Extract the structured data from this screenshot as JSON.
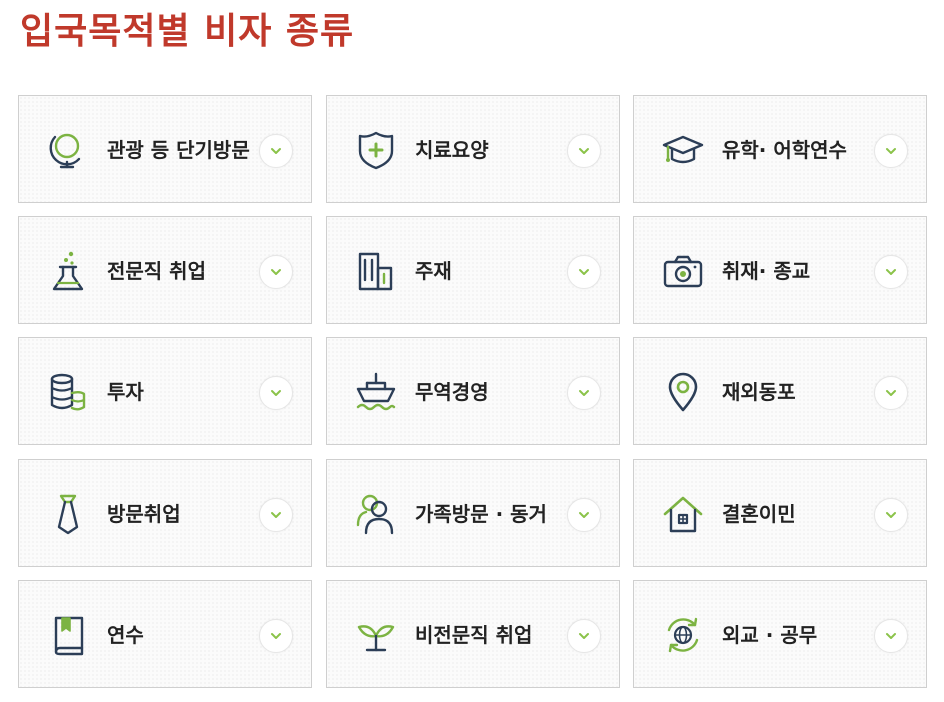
{
  "page": {
    "title": "입국목적별 비자 종류"
  },
  "colors": {
    "title": "#c0392b",
    "icon_navy": "#2c3e57",
    "icon_green": "#7cb342",
    "chevron": "#8bc34a"
  },
  "cards": [
    {
      "label": "관광 등 단기방문",
      "icon": "globe-icon"
    },
    {
      "label": "치료요양",
      "icon": "shield-cross-icon"
    },
    {
      "label": "유학· 어학연수",
      "icon": "graduation-cap-icon"
    },
    {
      "label": "전문직 취업",
      "icon": "flask-icon"
    },
    {
      "label": "주재",
      "icon": "building-icon"
    },
    {
      "label": "취재· 종교",
      "icon": "camera-icon"
    },
    {
      "label": "투자",
      "icon": "coin-stack-icon"
    },
    {
      "label": "무역경영",
      "icon": "ship-icon"
    },
    {
      "label": "재외동포",
      "icon": "map-pin-icon"
    },
    {
      "label": "방문취업",
      "icon": "necktie-icon"
    },
    {
      "label": "가족방문 · 동거",
      "icon": "family-icon"
    },
    {
      "label": "결혼이민",
      "icon": "house-icon"
    },
    {
      "label": "연수",
      "icon": "book-icon"
    },
    {
      "label": "비전문직 취업",
      "icon": "sprout-icon"
    },
    {
      "label": "외교 · 공무",
      "icon": "globe-arrows-icon"
    }
  ]
}
